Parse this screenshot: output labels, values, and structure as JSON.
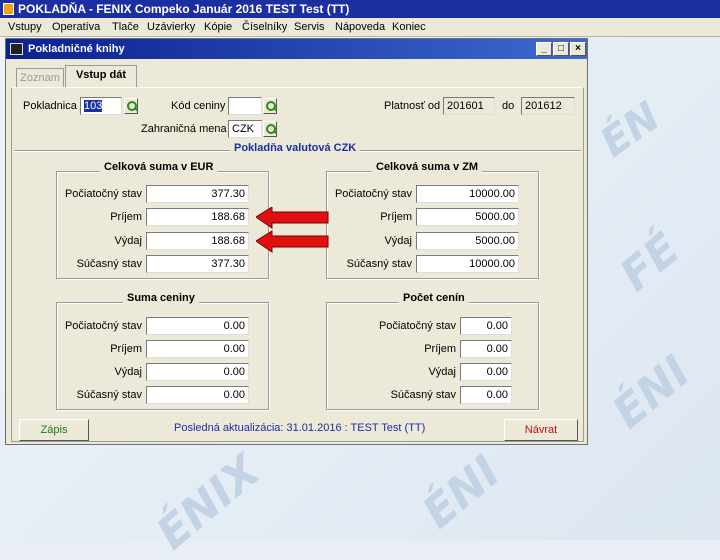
{
  "app": {
    "title": "POKLADŇA - FENIX Compeko  Január 2016  TEST Test  (TT)"
  },
  "menu": [
    "Vstupy",
    "Operatíva",
    "Tlače",
    "Uzávierky",
    "Kópie",
    "Číselníky",
    "Servis",
    "Nápoveda",
    "Koniec"
  ],
  "window": {
    "title": "Pokladničné knihy",
    "controls": {
      "minimize": "_",
      "maximize": "□",
      "close": "×"
    }
  },
  "tabs": [
    {
      "label": "Zoznam",
      "active": false
    },
    {
      "label": "Vstup dát",
      "active": true
    }
  ],
  "header": {
    "pokladnica_label": "Pokladnica",
    "pokladnica_value": "103",
    "kod_ceniny_label": "Kód ceniny",
    "kod_ceniny_value": "",
    "zahranicna_mena_label": "Zahraničná mena",
    "zahranicna_mena_value": "CZK",
    "platnost_od_label": "Platnosť od",
    "platnost_od_value": "201601",
    "do_label": "do",
    "do_value": "201612"
  },
  "section_title": "Pokladňa valutová CZK",
  "groups": {
    "eur": {
      "title": "Celková suma v EUR",
      "rows": [
        {
          "label": "Počiatočný stav",
          "value": "377.30"
        },
        {
          "label": "Príjem",
          "value": "188.68"
        },
        {
          "label": "Výdaj",
          "value": "188.68"
        },
        {
          "label": "Súčasný stav",
          "value": "377.30"
        }
      ]
    },
    "zm": {
      "title": "Celková suma v ZM",
      "rows": [
        {
          "label": "Počiatočný stav",
          "value": "10000.00"
        },
        {
          "label": "Príjem",
          "value": "5000.00"
        },
        {
          "label": "Výdaj",
          "value": "5000.00"
        },
        {
          "label": "Súčasný stav",
          "value": "10000.00"
        }
      ]
    },
    "suma_ceniny": {
      "title": "Suma ceniny",
      "rows": [
        {
          "label": "Počiatočný stav",
          "value": "0.00"
        },
        {
          "label": "Príjem",
          "value": "0.00"
        },
        {
          "label": "Výdaj",
          "value": "0.00"
        },
        {
          "label": "Súčasný stav",
          "value": "0.00"
        }
      ]
    },
    "pocet_cenin": {
      "title": "Počet cenín",
      "rows": [
        {
          "label": "Počiatočný stav",
          "value": "0.00"
        },
        {
          "label": "Príjem",
          "value": "0.00"
        },
        {
          "label": "Výdaj",
          "value": "0.00"
        },
        {
          "label": "Súčasný stav",
          "value": "0.00"
        }
      ]
    }
  },
  "footer": {
    "zapis_label": "Zápis",
    "status": "Posledná aktualizácia: 31.01.2016 : TEST Test   (TT)",
    "navrat_label": "Návrat"
  },
  "colors": {
    "title_bar": "#1b2fa0",
    "arrow": "#e01010",
    "accent_text": "#1b2fa0"
  },
  "icons": [
    "app-icon",
    "window-icon",
    "lookup-icon",
    "red-arrow-icon"
  ]
}
